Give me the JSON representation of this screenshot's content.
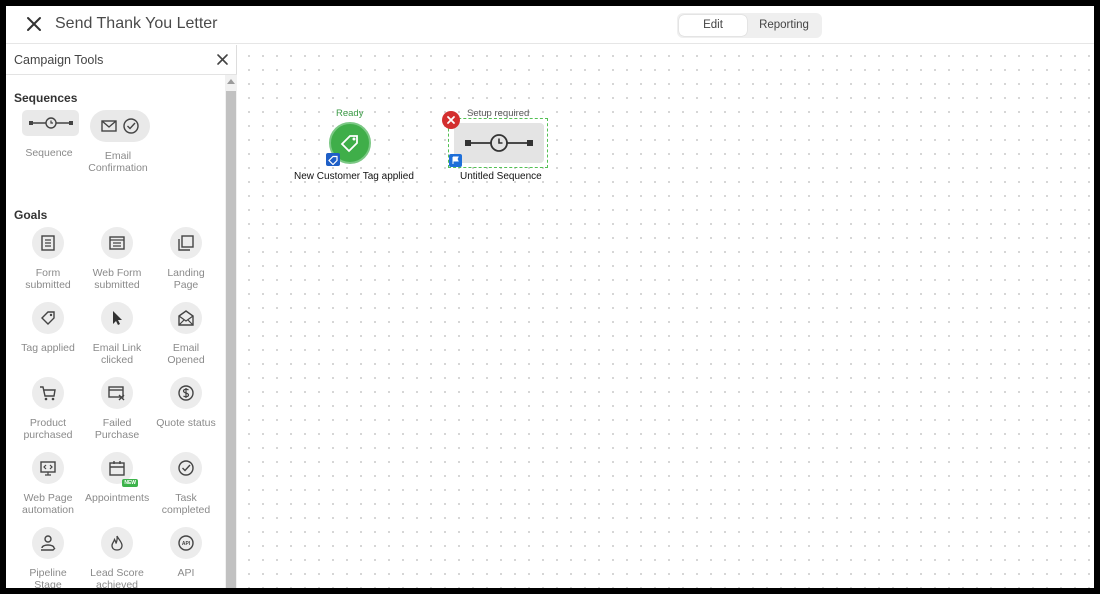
{
  "header": {
    "title": "Send Thank You Letter",
    "tabs": [
      {
        "label": "Edit",
        "active": true
      },
      {
        "label": "Reporting",
        "active": false
      }
    ]
  },
  "sidebar": {
    "title": "Campaign Tools",
    "sections": {
      "sequences": {
        "title": "Sequences",
        "items": [
          {
            "label": "Sequence",
            "icon": "sequence-icon"
          },
          {
            "label": "Email Confirmation",
            "icon": "email-confirmation-icon"
          }
        ]
      },
      "goals": {
        "title": "Goals",
        "items": [
          {
            "label": "Form submitted",
            "icon": "form-icon"
          },
          {
            "label": "Web Form submitted",
            "icon": "web-form-icon"
          },
          {
            "label": "Landing Page",
            "icon": "landing-page-icon"
          },
          {
            "label": "Tag applied",
            "icon": "tag-icon"
          },
          {
            "label": "Email Link clicked",
            "icon": "cursor-icon"
          },
          {
            "label": "Email Opened",
            "icon": "open-envelope-icon"
          },
          {
            "label": "Product purchased",
            "icon": "cart-icon"
          },
          {
            "label": "Failed Purchase",
            "icon": "failed-card-icon"
          },
          {
            "label": "Quote status",
            "icon": "dollar-icon"
          },
          {
            "label": "Web Page automation",
            "icon": "code-monitor-icon"
          },
          {
            "label": "Appointments",
            "icon": "calendar-icon",
            "badge": "NEW"
          },
          {
            "label": "Task completed",
            "icon": "check-circle-icon"
          },
          {
            "label": "Pipeline Stage",
            "icon": "pipeline-icon"
          },
          {
            "label": "Lead Score achieved",
            "icon": "flame-icon"
          },
          {
            "label": "API",
            "icon": "api-icon"
          }
        ]
      }
    }
  },
  "canvas": {
    "nodes": [
      {
        "status": "Ready",
        "label": "New Customer Tag applied",
        "type": "goal",
        "icon": "tag-icon",
        "color": "#3fae49"
      },
      {
        "status": "Setup required",
        "label": "Untitled Sequence",
        "type": "sequence",
        "icon": "sequence-icon",
        "error": true
      }
    ]
  },
  "colors": {
    "accent_green": "#3fae49",
    "error_red": "#d32f2f",
    "badge_blue": "#1e5fc7"
  }
}
